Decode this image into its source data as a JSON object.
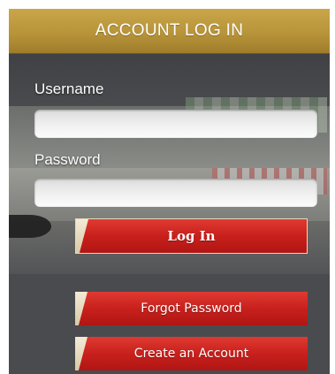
{
  "header": {
    "title": "ACCOUNT LOG IN"
  },
  "form": {
    "username_label": "Username",
    "username_value": "",
    "password_label": "Password",
    "password_value": ""
  },
  "buttons": {
    "login_label": "Log In",
    "forgot_label": "Forgot Password",
    "create_label": "Create an Account"
  },
  "colors": {
    "header_gold": "#b8943a",
    "button_red": "#c8201c",
    "panel_gray": "#46474a"
  }
}
